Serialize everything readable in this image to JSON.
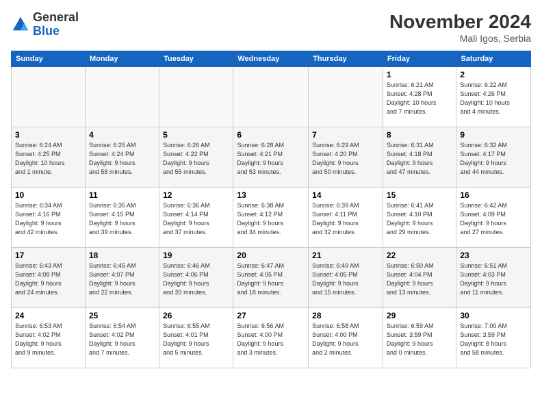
{
  "logo": {
    "general": "General",
    "blue": "Blue"
  },
  "header": {
    "month": "November 2024",
    "location": "Mali Igos, Serbia"
  },
  "weekdays": [
    "Sunday",
    "Monday",
    "Tuesday",
    "Wednesday",
    "Thursday",
    "Friday",
    "Saturday"
  ],
  "weeks": [
    [
      {
        "day": "",
        "info": ""
      },
      {
        "day": "",
        "info": ""
      },
      {
        "day": "",
        "info": ""
      },
      {
        "day": "",
        "info": ""
      },
      {
        "day": "",
        "info": ""
      },
      {
        "day": "1",
        "info": "Sunrise: 6:21 AM\nSunset: 4:28 PM\nDaylight: 10 hours\nand 7 minutes."
      },
      {
        "day": "2",
        "info": "Sunrise: 6:22 AM\nSunset: 4:26 PM\nDaylight: 10 hours\nand 4 minutes."
      }
    ],
    [
      {
        "day": "3",
        "info": "Sunrise: 6:24 AM\nSunset: 4:25 PM\nDaylight: 10 hours\nand 1 minute."
      },
      {
        "day": "4",
        "info": "Sunrise: 6:25 AM\nSunset: 4:24 PM\nDaylight: 9 hours\nand 58 minutes."
      },
      {
        "day": "5",
        "info": "Sunrise: 6:26 AM\nSunset: 4:22 PM\nDaylight: 9 hours\nand 55 minutes."
      },
      {
        "day": "6",
        "info": "Sunrise: 6:28 AM\nSunset: 4:21 PM\nDaylight: 9 hours\nand 53 minutes."
      },
      {
        "day": "7",
        "info": "Sunrise: 6:29 AM\nSunset: 4:20 PM\nDaylight: 9 hours\nand 50 minutes."
      },
      {
        "day": "8",
        "info": "Sunrise: 6:31 AM\nSunset: 4:18 PM\nDaylight: 9 hours\nand 47 minutes."
      },
      {
        "day": "9",
        "info": "Sunrise: 6:32 AM\nSunset: 4:17 PM\nDaylight: 9 hours\nand 44 minutes."
      }
    ],
    [
      {
        "day": "10",
        "info": "Sunrise: 6:34 AM\nSunset: 4:16 PM\nDaylight: 9 hours\nand 42 minutes."
      },
      {
        "day": "11",
        "info": "Sunrise: 6:35 AM\nSunset: 4:15 PM\nDaylight: 9 hours\nand 39 minutes."
      },
      {
        "day": "12",
        "info": "Sunrise: 6:36 AM\nSunset: 4:14 PM\nDaylight: 9 hours\nand 37 minutes."
      },
      {
        "day": "13",
        "info": "Sunrise: 6:38 AM\nSunset: 4:12 PM\nDaylight: 9 hours\nand 34 minutes."
      },
      {
        "day": "14",
        "info": "Sunrise: 6:39 AM\nSunset: 4:11 PM\nDaylight: 9 hours\nand 32 minutes."
      },
      {
        "day": "15",
        "info": "Sunrise: 6:41 AM\nSunset: 4:10 PM\nDaylight: 9 hours\nand 29 minutes."
      },
      {
        "day": "16",
        "info": "Sunrise: 6:42 AM\nSunset: 4:09 PM\nDaylight: 9 hours\nand 27 minutes."
      }
    ],
    [
      {
        "day": "17",
        "info": "Sunrise: 6:43 AM\nSunset: 4:08 PM\nDaylight: 9 hours\nand 24 minutes."
      },
      {
        "day": "18",
        "info": "Sunrise: 6:45 AM\nSunset: 4:07 PM\nDaylight: 9 hours\nand 22 minutes."
      },
      {
        "day": "19",
        "info": "Sunrise: 6:46 AM\nSunset: 4:06 PM\nDaylight: 9 hours\nand 20 minutes."
      },
      {
        "day": "20",
        "info": "Sunrise: 6:47 AM\nSunset: 4:05 PM\nDaylight: 9 hours\nand 18 minutes."
      },
      {
        "day": "21",
        "info": "Sunrise: 6:49 AM\nSunset: 4:05 PM\nDaylight: 9 hours\nand 15 minutes."
      },
      {
        "day": "22",
        "info": "Sunrise: 6:50 AM\nSunset: 4:04 PM\nDaylight: 9 hours\nand 13 minutes."
      },
      {
        "day": "23",
        "info": "Sunrise: 6:51 AM\nSunset: 4:03 PM\nDaylight: 9 hours\nand 11 minutes."
      }
    ],
    [
      {
        "day": "24",
        "info": "Sunrise: 6:53 AM\nSunset: 4:02 PM\nDaylight: 9 hours\nand 9 minutes."
      },
      {
        "day": "25",
        "info": "Sunrise: 6:54 AM\nSunset: 4:02 PM\nDaylight: 9 hours\nand 7 minutes."
      },
      {
        "day": "26",
        "info": "Sunrise: 6:55 AM\nSunset: 4:01 PM\nDaylight: 9 hours\nand 5 minutes."
      },
      {
        "day": "27",
        "info": "Sunrise: 6:56 AM\nSunset: 4:00 PM\nDaylight: 9 hours\nand 3 minutes."
      },
      {
        "day": "28",
        "info": "Sunrise: 6:58 AM\nSunset: 4:00 PM\nDaylight: 9 hours\nand 2 minutes."
      },
      {
        "day": "29",
        "info": "Sunrise: 6:59 AM\nSunset: 3:59 PM\nDaylight: 9 hours\nand 0 minutes."
      },
      {
        "day": "30",
        "info": "Sunrise: 7:00 AM\nSunset: 3:59 PM\nDaylight: 8 hours\nand 58 minutes."
      }
    ]
  ]
}
